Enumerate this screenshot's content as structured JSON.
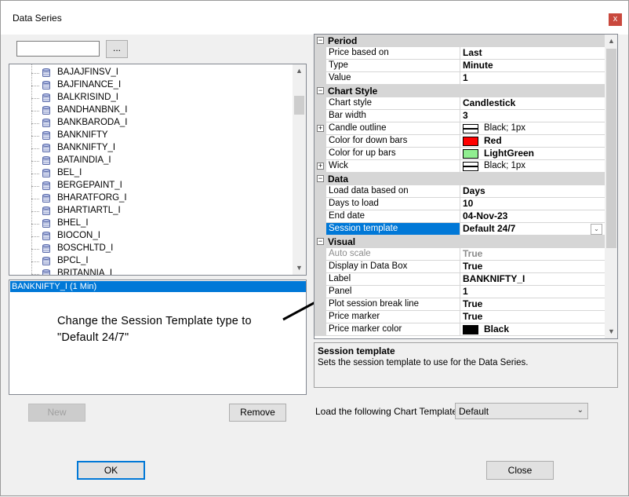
{
  "window": {
    "title": "Data Series",
    "close_glyph": "x"
  },
  "left": {
    "search_value": "",
    "browse_label": "...",
    "instruments": [
      "BAJAJFINSV_I",
      "BAJFINANCE_I",
      "BALKRISIND_I",
      "BANDHANBNK_I",
      "BANKBARODA_I",
      "BANKNIFTY",
      "BANKNIFTY_I",
      "BATAINDIA_I",
      "BEL_I",
      "BERGEPAINT_I",
      "BHARATFORG_I",
      "BHARTIARTL_I",
      "BHEL_I",
      "BIOCON_I",
      "BOSCHLTD_I",
      "BPCL_I",
      "BRITANNIA_I"
    ],
    "selected_series": "BANKNIFTY_I (1 Min)",
    "new_label": "New",
    "remove_label": "Remove"
  },
  "annotation": {
    "line1": "Change the Session Template type to",
    "line2": "\"Default 24/7\""
  },
  "properties": {
    "period": {
      "title": "Period",
      "rows": [
        {
          "name": "Price based on",
          "value": "Last"
        },
        {
          "name": "Type",
          "value": "Minute"
        },
        {
          "name": "Value",
          "value": "1"
        }
      ]
    },
    "chart_style": {
      "title": "Chart Style",
      "rows": [
        {
          "name": "Chart style",
          "value": "Candlestick"
        },
        {
          "name": "Bar width",
          "value": "3"
        },
        {
          "name": "Candle outline",
          "value": "Black; 1px"
        },
        {
          "name": "Color for down bars",
          "value": "Red"
        },
        {
          "name": "Color for up bars",
          "value": "LightGreen"
        },
        {
          "name": "Wick",
          "value": "Black; 1px"
        }
      ]
    },
    "data": {
      "title": "Data",
      "rows": [
        {
          "name": "Load data based on",
          "value": "Days"
        },
        {
          "name": "Days to load",
          "value": "10"
        },
        {
          "name": "End date",
          "value": "04-Nov-23"
        },
        {
          "name": "Session template",
          "value": "Default 24/7"
        }
      ]
    },
    "visual": {
      "title": "Visual",
      "rows": [
        {
          "name": "Auto scale",
          "value": "True"
        },
        {
          "name": "Display in Data Box",
          "value": "True"
        },
        {
          "name": "Label",
          "value": "BANKNIFTY_I"
        },
        {
          "name": "Panel",
          "value": "1"
        },
        {
          "name": "Plot session break line",
          "value": "True"
        },
        {
          "name": "Price marker",
          "value": "True"
        },
        {
          "name": "Price marker color",
          "value": "Black"
        }
      ]
    },
    "colors": {
      "red": "#ff0000",
      "lightgreen": "#90ee90",
      "black": "#000000",
      "selection": "#0078d7"
    }
  },
  "description": {
    "title": "Session template",
    "text": "Sets the session template to use for the Data Series."
  },
  "chart_template": {
    "label": "Load the following Chart Template:",
    "value": "Default"
  },
  "footer": {
    "ok_label": "OK",
    "close_label": "Close"
  }
}
